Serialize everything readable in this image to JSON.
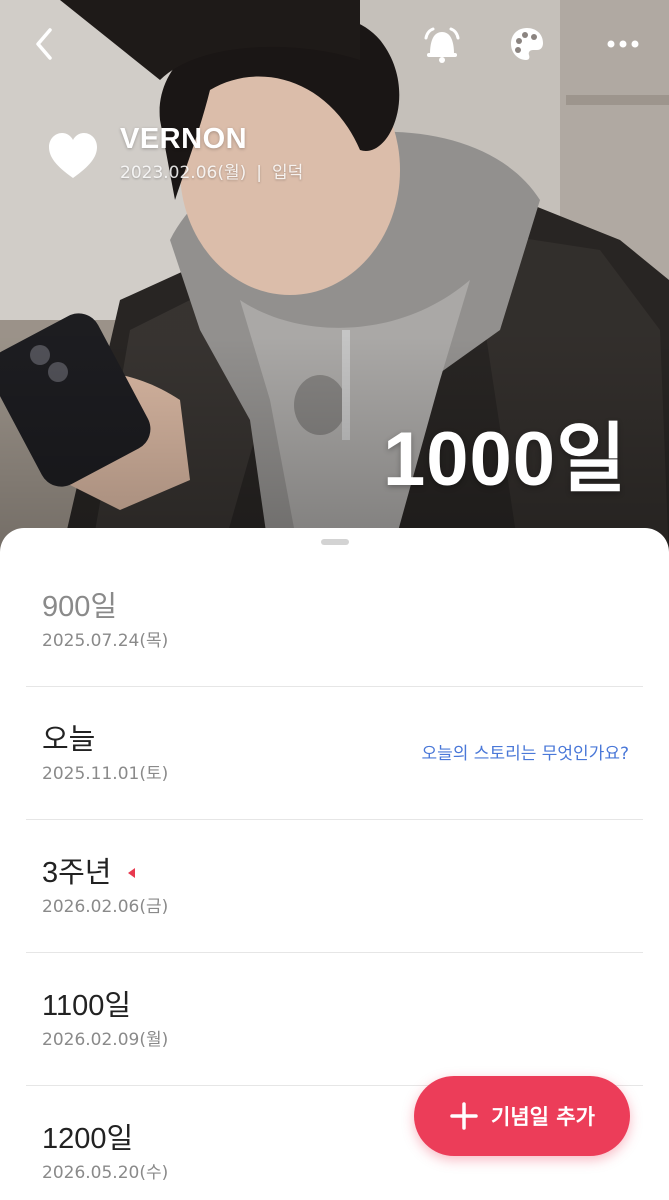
{
  "header": {
    "name": "VERNON",
    "start_date": "2023.02.06(월)",
    "separator": "|",
    "event_label": "입덕",
    "day_count": "1000일"
  },
  "icons": {
    "back": "chevron-left-icon",
    "alarm": "bell-icon",
    "theme": "palette-icon",
    "more": "more-dots-icon",
    "favorite": "heart-icon",
    "tag": "red-tag-icon",
    "add": "plus-icon"
  },
  "anniversaries": [
    {
      "title": "900일",
      "date": "2025.07.24(목)"
    },
    {
      "title": "오늘",
      "date": "2025.11.01(토)",
      "link": "오늘의 스토리는 무엇인가요?"
    },
    {
      "title": "3주년",
      "date": "2026.02.06(금)"
    },
    {
      "title": "1100일",
      "date": "2026.02.09(월)"
    },
    {
      "title": "1200일",
      "date": "2026.05.20(수)"
    }
  ],
  "fab": {
    "label": "기념일 추가"
  },
  "colors": {
    "accent": "#ec3d59",
    "link": "#4a78d8",
    "muted_text": "#8a8a8a",
    "primary_text": "#222222"
  }
}
